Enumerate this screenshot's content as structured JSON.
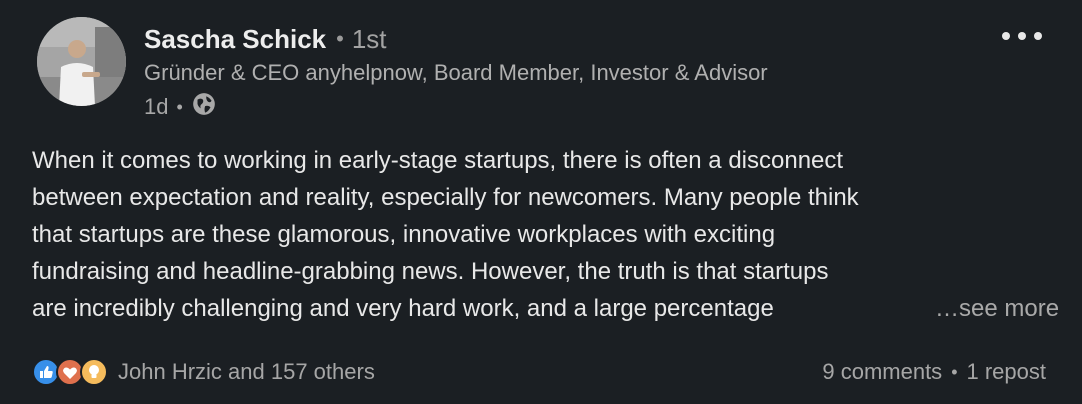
{
  "post": {
    "author": {
      "name": "Sascha Schick",
      "degree": "1st",
      "headline": "Gründer & CEO anyhelpnow, Board Member, Investor & Advisor",
      "time": "1d",
      "visibility_icon": "globe-icon"
    },
    "separator": "•",
    "more_icon": "more-horizontal-icon",
    "text_lines": [
      "When it comes to working in early-stage startups, there is often a disconnect",
      "between expectation and reality, especially for newcomers. Many people think",
      "that startups are these glamorous, innovative workplaces with exciting",
      "fundraising and headline-grabbing news. However, the truth is that startups",
      "are incredibly challenging and very hard work, and a large percentage"
    ],
    "see_more": "…see more",
    "reactions": {
      "icons": [
        "like-icon",
        "love-icon",
        "insightful-icon"
      ],
      "summary": "John Hrzic and 157 others"
    },
    "comments": "9 comments",
    "reposts": "1 repost"
  },
  "colors": {
    "background": "#1b1f23",
    "like": "#378fe9",
    "love": "#df704d",
    "insightful": "#f5bb5c"
  }
}
